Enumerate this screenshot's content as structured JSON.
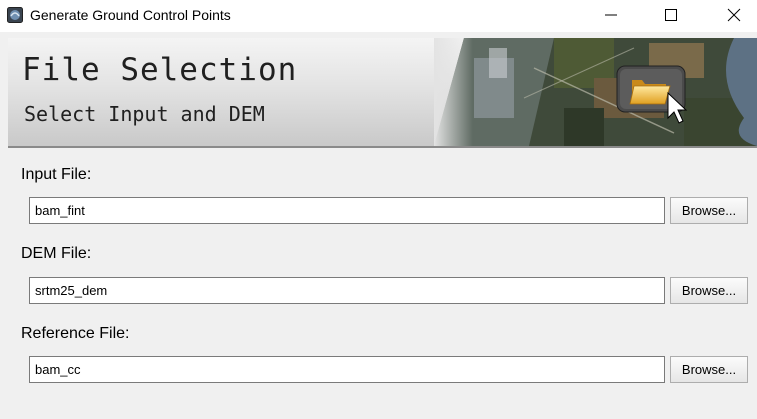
{
  "window": {
    "title": "Generate Ground Control Points",
    "icon": "app-icon"
  },
  "controls": {
    "minimize": "minimize-icon",
    "maximize": "maximize-icon",
    "close": "close-icon"
  },
  "banner": {
    "title": "File Selection",
    "subtitle": "Select Input and DEM",
    "image": "satellite-image-with-folder-icon"
  },
  "fields": {
    "input": {
      "label": "Input File:",
      "value": "bam_fint",
      "button_label": "Browse..."
    },
    "dem": {
      "label": "DEM File:",
      "value": "srtm25_dem",
      "button_label": "Browse..."
    },
    "reference": {
      "label": "Reference File:",
      "value": "bam_cc",
      "button_label": "Browse..."
    }
  }
}
